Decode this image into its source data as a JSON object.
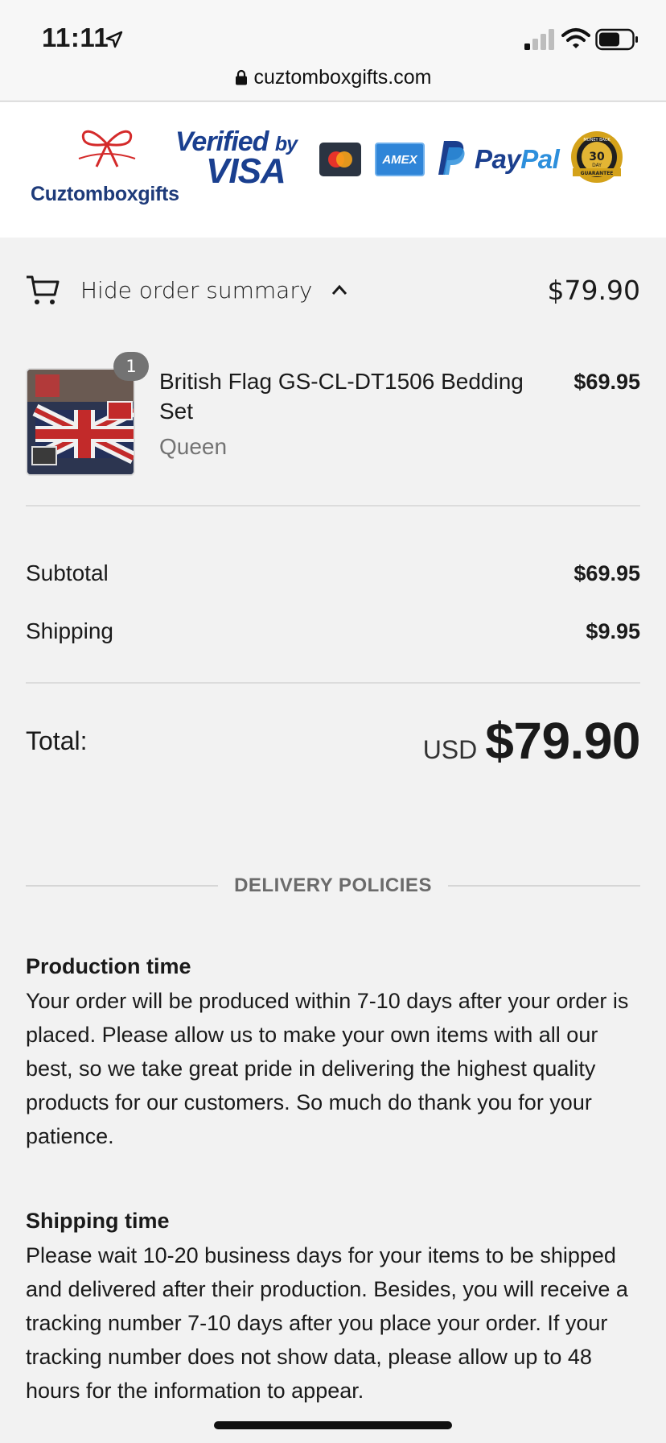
{
  "status_bar": {
    "time": "11:11",
    "url": "cuztomboxgifts.com"
  },
  "header_logos": {
    "brand_name": "Cuztomboxgifts",
    "verified_line1": "Verified",
    "verified_by": "by",
    "verified_line2": "VISA",
    "amex": "AMEX",
    "paypal_pay": "Pay",
    "paypal_pal": "Pal",
    "badge_lines": [
      "MONEY BACK",
      "30",
      "DAY",
      "GUARANTEE"
    ]
  },
  "summary": {
    "toggle_label": "Hide order summary",
    "toggle_total": "$79.90",
    "items": [
      {
        "quantity": "1",
        "name": "British Flag GS-CL-DT1506 Bedding Set",
        "variant": "Queen",
        "price": "$69.95"
      }
    ],
    "subtotal_label": "Subtotal",
    "subtotal_value": "$69.95",
    "shipping_label": "Shipping",
    "shipping_value": "$9.95",
    "total_label": "Total:",
    "total_currency": "USD",
    "total_amount": "$79.90"
  },
  "policies": {
    "heading": "DELIVERY POLICIES",
    "sections": [
      {
        "title": "Production time",
        "text": "Your order will be produced within 7-10 days after your order is placed. Please allow us to make your own items with all our best, so we take great pride in delivering the highest quality products for our customers. So much do thank you for your patience."
      },
      {
        "title": "Shipping time",
        "text": "Please wait 10-20 business days for your items to be shipped and delivered after their production. Besides, you will receive a tracking number 7-10 days after you place your order. If your tracking number does not show data, please allow up to 48 hours for the information to appear."
      }
    ]
  },
  "colors": {
    "background": "#f2f2f2",
    "brand_blue": "#1a3f8f",
    "brand_red": "#d42a2a",
    "muted_text": "#737373"
  }
}
